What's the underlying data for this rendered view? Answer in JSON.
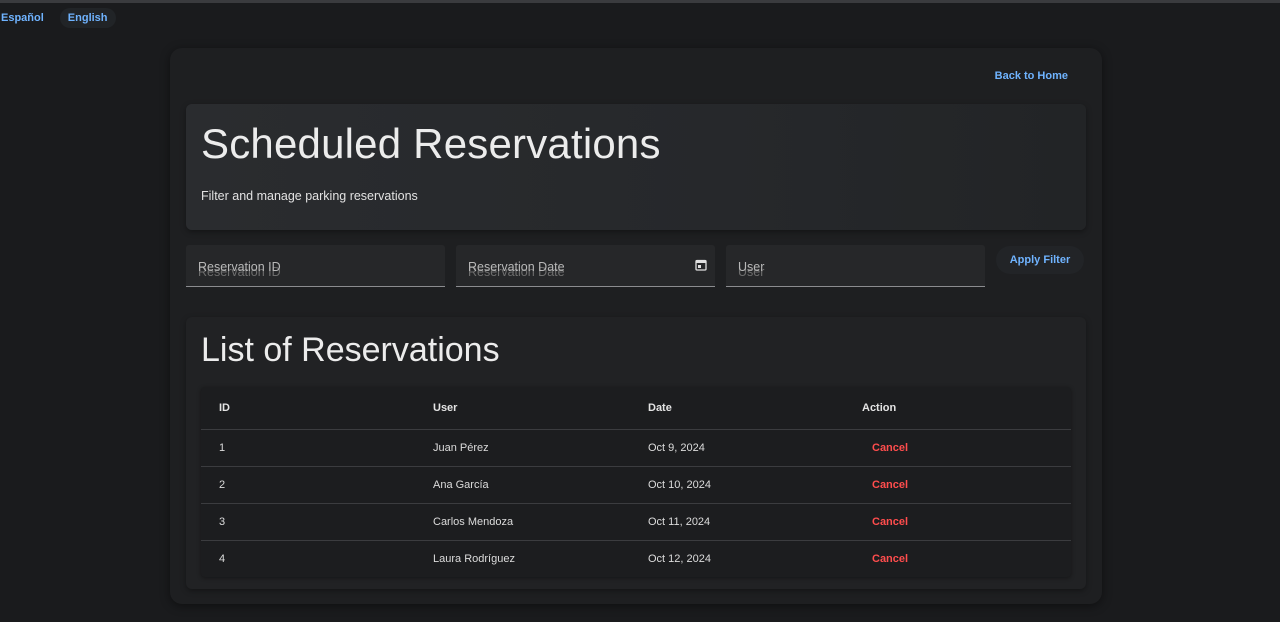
{
  "languages": [
    "Español",
    "English"
  ],
  "nav": {
    "back_label": "Back to Home"
  },
  "hero": {
    "title": "Scheduled Reservations",
    "subtitle": "Filter and manage parking reservations"
  },
  "filters": {
    "reservation_id_placeholder": "Reservation ID",
    "reservation_date_placeholder": "Reservation Date",
    "user_placeholder": "User",
    "apply_label": "Apply Filter"
  },
  "list": {
    "title": "List of Reservations",
    "columns": [
      "ID",
      "User",
      "Date",
      "Action"
    ],
    "rows": [
      {
        "id": "1",
        "user": "Juan Pérez",
        "date": "Oct 9, 2024",
        "action": "Cancel"
      },
      {
        "id": "2",
        "user": "Ana García",
        "date": "Oct 10, 2024",
        "action": "Cancel"
      },
      {
        "id": "3",
        "user": "Carlos Mendoza",
        "date": "Oct 11, 2024",
        "action": "Cancel"
      },
      {
        "id": "4",
        "user": "Laura Rodríguez",
        "date": "Oct 12, 2024",
        "action": "Cancel"
      }
    ]
  },
  "colors": {
    "background": "#1a1b1d",
    "link": "#6fb3ff",
    "danger": "#ff4d4d"
  },
  "icons": {
    "date_picker": "calendar-icon"
  }
}
